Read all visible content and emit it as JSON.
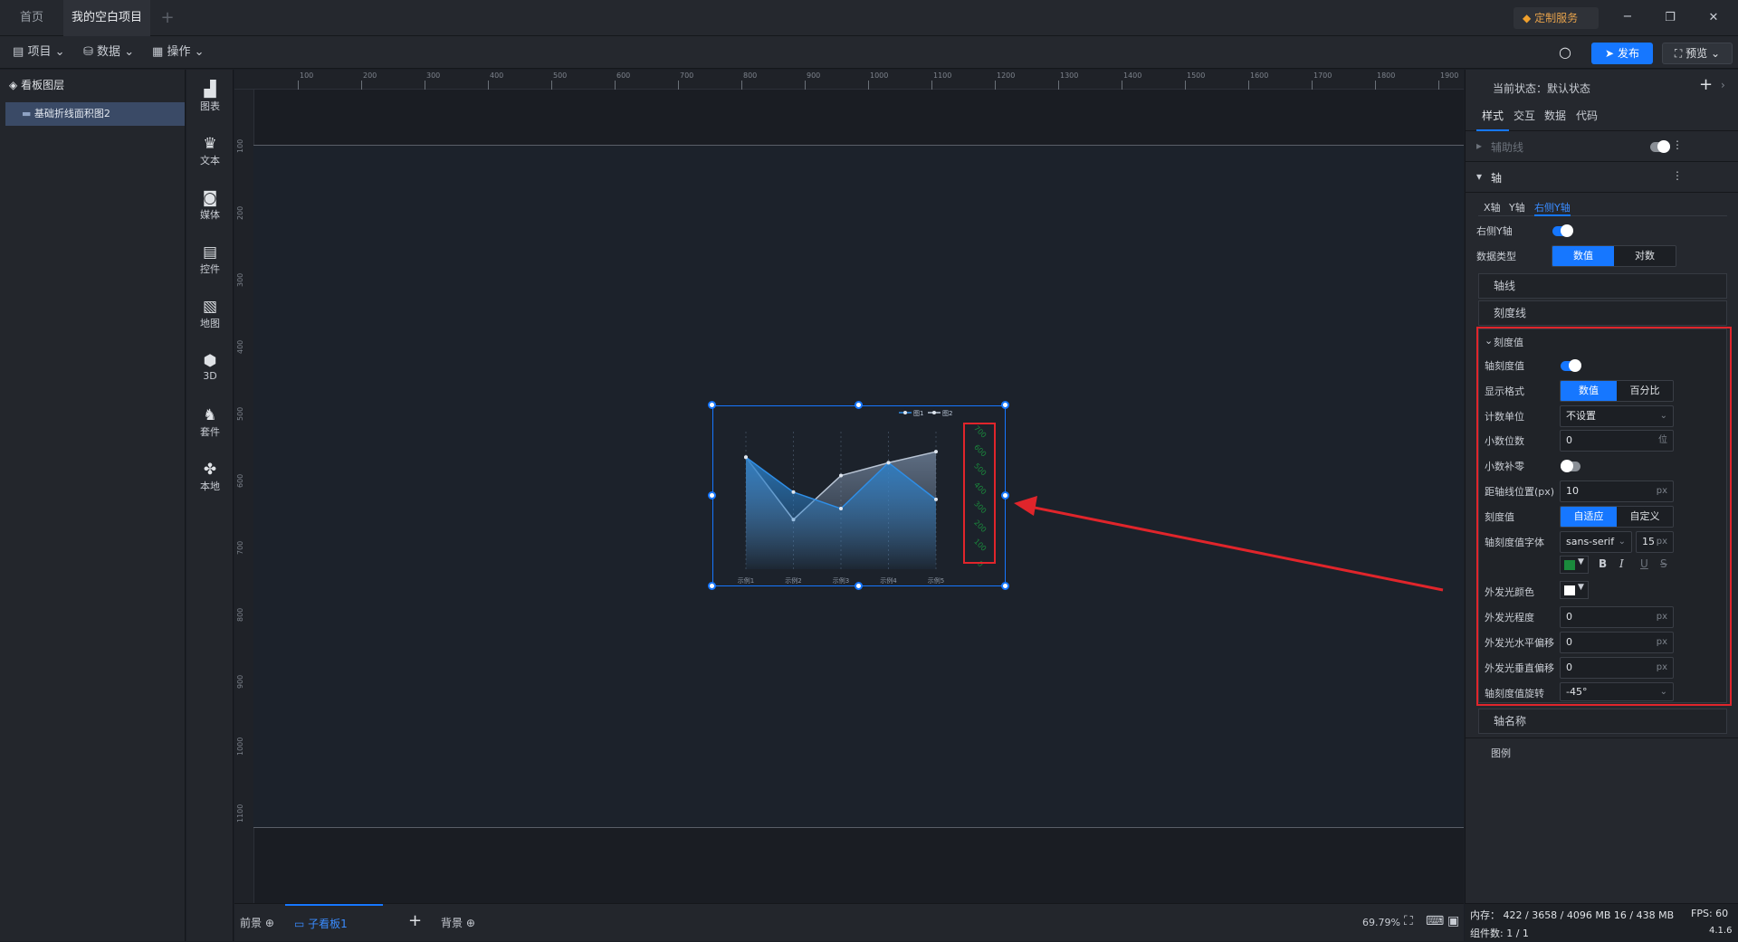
{
  "tabs": [
    {
      "label": "首页"
    },
    {
      "label": "我的空白项目"
    }
  ],
  "window": {
    "service_label": "定制服务"
  },
  "menu": {
    "project": "项目",
    "data": "数据",
    "operate": "操作",
    "publish": "发布",
    "preview": "预览"
  },
  "layers": {
    "title": "看板图层",
    "item": "基础折线面积图2"
  },
  "tools": [
    {
      "label": "图表",
      "icon": "bar-chart-icon"
    },
    {
      "label": "文本",
      "icon": "text-icon"
    },
    {
      "label": "媒体",
      "icon": "media-icon"
    },
    {
      "label": "控件",
      "icon": "control-icon"
    },
    {
      "label": "地图",
      "icon": "map-icon"
    },
    {
      "label": "3D",
      "icon": "cube-icon"
    },
    {
      "label": "套件",
      "icon": "kit-icon"
    },
    {
      "label": "本地",
      "icon": "puzzle-icon"
    }
  ],
  "ruler": {
    "h": [
      "100",
      "200",
      "300",
      "400",
      "500",
      "600",
      "700",
      "800",
      "900",
      "1000",
      "1100",
      "1200",
      "1300",
      "1400",
      "1500",
      "1600",
      "1700",
      "1800",
      "1900"
    ],
    "v": [
      "100",
      "200",
      "300",
      "400",
      "500",
      "600",
      "700",
      "800",
      "900",
      "1000",
      "1100"
    ]
  },
  "chart": {
    "legend": [
      "图1",
      "图2"
    ],
    "categories": [
      "示例1",
      "示例2",
      "示例3",
      "示例4",
      "示例5"
    ],
    "right_axis": [
      "700",
      "600",
      "500",
      "400",
      "300",
      "200",
      "100",
      "0"
    ]
  },
  "chart_data": {
    "type": "area",
    "categories": [
      "示例1",
      "示例2",
      "示例3",
      "示例4",
      "示例5"
    ],
    "series": [
      {
        "name": "图1",
        "values": [
          610,
          420,
          330,
          580,
          380
        ]
      },
      {
        "name": "图2",
        "values": [
          610,
          270,
          510,
          580,
          640
        ]
      }
    ],
    "ylim": [
      0,
      700
    ],
    "right_axis_ticks": [
      "700",
      "600",
      "500",
      "400",
      "300",
      "200",
      "100",
      "0"
    ],
    "right_axis_rotation": "-45°",
    "legend_placement": "top-right"
  },
  "bottombar": {
    "front": "前景",
    "sub": "子看板1",
    "back": "背景",
    "zoom": "69.79%"
  },
  "panel": {
    "state_label": "当前状态：默认状态",
    "tabs": [
      "样式",
      "交互",
      "数据",
      "代码"
    ],
    "guides": "辅助线",
    "axis": "轴",
    "axis_tabs": [
      "X轴",
      "Y轴",
      "右侧Y轴"
    ],
    "right_y_label": "右侧Y轴",
    "data_type_label": "数据类型",
    "data_type_options": [
      "数值",
      "对数"
    ],
    "axis_line": "轴线",
    "tick_line": "刻度线",
    "tick_value_section": "刻度值",
    "tick_value_toggle": "轴刻度值",
    "display_format": "显示格式",
    "display_format_options": [
      "数值",
      "百分比"
    ],
    "count_unit": "计数单位",
    "count_unit_value": "不设置",
    "decimals": "小数位数",
    "decimals_value": "0",
    "decimals_unit": "位",
    "decimal_pad": "小数补零",
    "distance": "距轴线位置(px)",
    "distance_value": "10",
    "tick_mode": "刻度值",
    "tick_mode_options": [
      "自适应",
      "自定义"
    ],
    "font_label": "轴刻度值字体",
    "font_value": "sans-serif",
    "font_size": "15",
    "glow_color": "外发光颜色",
    "glow_degree": "外发光程度",
    "glow_degree_value": "0",
    "glow_h": "外发光水平偏移",
    "glow_h_value": "0",
    "glow_v": "外发光垂直偏移",
    "glow_v_value": "0",
    "rotation": "轴刻度值旋转",
    "rotation_value": "-45°",
    "axis_name": "轴名称",
    "legend": "图例",
    "px": "px",
    "text_color": "#1a8a3c",
    "glow_swatch": "#ffffff"
  },
  "footer": {
    "memory": "内存： 422 / 3658 / 4096 MB 16 / 438 MB",
    "fps": "FPS: 60",
    "components": "组件数: 1 / 1",
    "version": "4.1.6"
  }
}
